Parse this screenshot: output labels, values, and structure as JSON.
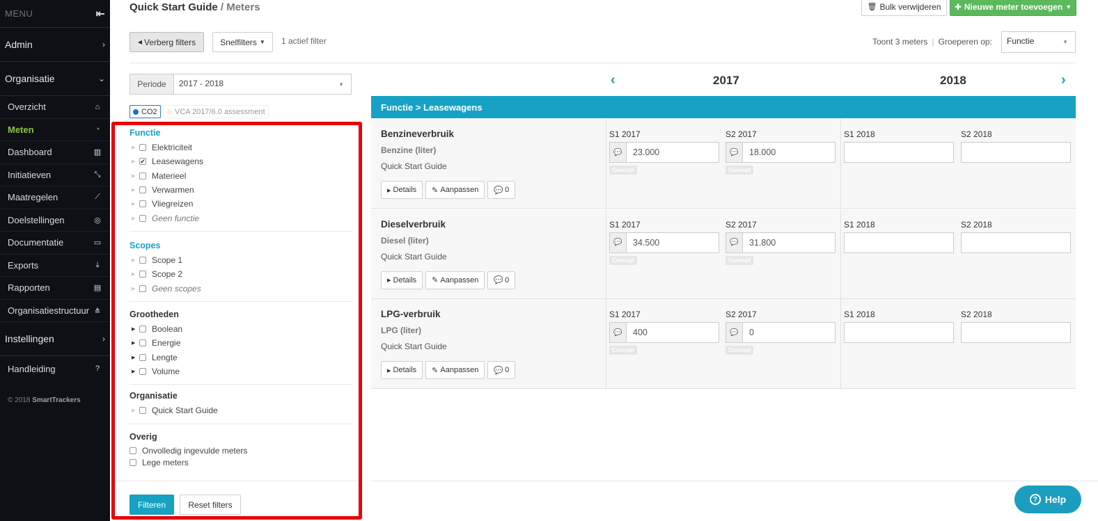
{
  "sidebar": {
    "menu_label": "MENU",
    "admin": "Admin",
    "organisatie": "Organisatie",
    "items": [
      {
        "label": "Overzicht",
        "icon": "home-icon",
        "glyph": "⌂"
      },
      {
        "label": "Meten",
        "icon": "gauge-icon",
        "glyph": "◔"
      },
      {
        "label": "Dashboard",
        "icon": "bar-chart-icon",
        "glyph": "▥"
      },
      {
        "label": "Initiatieven",
        "icon": "compress-icon",
        "glyph": "⤡"
      },
      {
        "label": "Maatregelen",
        "icon": "line-chart-icon",
        "glyph": "⟋"
      },
      {
        "label": "Doelstellingen",
        "icon": "target-icon",
        "glyph": "◎"
      },
      {
        "label": "Documentatie",
        "icon": "folder-open-icon",
        "glyph": "▭"
      },
      {
        "label": "Exports",
        "icon": "download-icon",
        "glyph": "⤓"
      },
      {
        "label": "Rapporten",
        "icon": "file-icon",
        "glyph": "▤"
      },
      {
        "label": "Organisatiestructuur",
        "icon": "sitemap-icon",
        "glyph": "⋔"
      }
    ],
    "instellingen": "Instellingen",
    "handleiding": "Handleiding",
    "copyright_prefix": "© 2018",
    "copyright_brand": "SmartTrackers"
  },
  "header": {
    "title": "Quick Start Guide",
    "subtitle": "/ Meters",
    "bulk_delete": "Bulk verwijderen",
    "new_meter": "Nieuwe meter toevoegen"
  },
  "toolbar": {
    "hide_filters": "Verberg filters",
    "quick_filters": "Snelfilters",
    "active_filter": "1 actief filter",
    "showing": "Toont 3 meters",
    "group_by_label": "Groeperen op:",
    "group_by_value": "Functie"
  },
  "period": {
    "label": "Periode",
    "value": "2017 - 2018"
  },
  "tags": {
    "co2": "CO2",
    "vca": "VCA 2017/6.0 assessment"
  },
  "filters": {
    "functie": {
      "title": "Functie",
      "options": [
        {
          "label": "Elektriciteit",
          "checked": false
        },
        {
          "label": "Leasewagens",
          "checked": true
        },
        {
          "label": "Materieel",
          "checked": false
        },
        {
          "label": "Verwarmen",
          "checked": false
        },
        {
          "label": "Vliegreizen",
          "checked": false
        },
        {
          "label": "Geen functie",
          "checked": false
        }
      ]
    },
    "scopes": {
      "title": "Scopes",
      "options": [
        {
          "label": "Scope 1"
        },
        {
          "label": "Scope 2"
        },
        {
          "label": "Geen scopes"
        }
      ]
    },
    "grootheden": {
      "title": "Grootheden",
      "options": [
        {
          "label": "Boolean"
        },
        {
          "label": "Energie"
        },
        {
          "label": "Lengte"
        },
        {
          "label": "Volume"
        }
      ]
    },
    "organisatie": {
      "title": "Organisatie",
      "options": [
        {
          "label": "Quick Start Guide"
        }
      ]
    },
    "overig": {
      "title": "Overig",
      "options": [
        {
          "label": "Onvolledig ingevulde meters"
        },
        {
          "label": "Lege meters"
        }
      ]
    },
    "apply": "Filteren",
    "reset": "Reset filters"
  },
  "years": [
    "2017",
    "2018"
  ],
  "group_header": "Functie > Leasewagens",
  "meters": [
    {
      "name": "Benzineverbruik",
      "unit": "Benzine (liter)",
      "org": "Quick Start Guide",
      "periods": [
        {
          "label": "S1 2017",
          "value": "23.000",
          "badge": "Concept"
        },
        {
          "label": "S2 2017",
          "value": "18.000",
          "badge": "Concept"
        },
        {
          "label": "S1 2018",
          "value": "",
          "badge": ""
        },
        {
          "label": "S2 2018",
          "value": "",
          "badge": ""
        }
      ],
      "comments": "0"
    },
    {
      "name": "Dieselverbruik",
      "unit": "Diesel (liter)",
      "org": "Quick Start Guide",
      "periods": [
        {
          "label": "S1 2017",
          "value": "34.500",
          "badge": "Concept"
        },
        {
          "label": "S2 2017",
          "value": "31.800",
          "badge": "Concept"
        },
        {
          "label": "S1 2018",
          "value": "",
          "badge": ""
        },
        {
          "label": "S2 2018",
          "value": "",
          "badge": ""
        }
      ],
      "comments": "0"
    },
    {
      "name": "LPG-verbruik",
      "unit": "LPG (liter)",
      "org": "Quick Start Guide",
      "periods": [
        {
          "label": "S1 2017",
          "value": "400",
          "badge": "Concept"
        },
        {
          "label": "S2 2017",
          "value": "0",
          "badge": "Concept"
        },
        {
          "label": "S1 2018",
          "value": "",
          "badge": ""
        },
        {
          "label": "S2 2018",
          "value": "",
          "badge": ""
        }
      ],
      "comments": "0"
    }
  ],
  "row_actions": {
    "details": "Details",
    "edit": "Aanpassen"
  },
  "help": "Help",
  "colors": {
    "accent": "#16a2c4",
    "active_nav": "#8cc63f",
    "primary_green": "#5cb85c",
    "highlight_border": "#e8000b"
  }
}
